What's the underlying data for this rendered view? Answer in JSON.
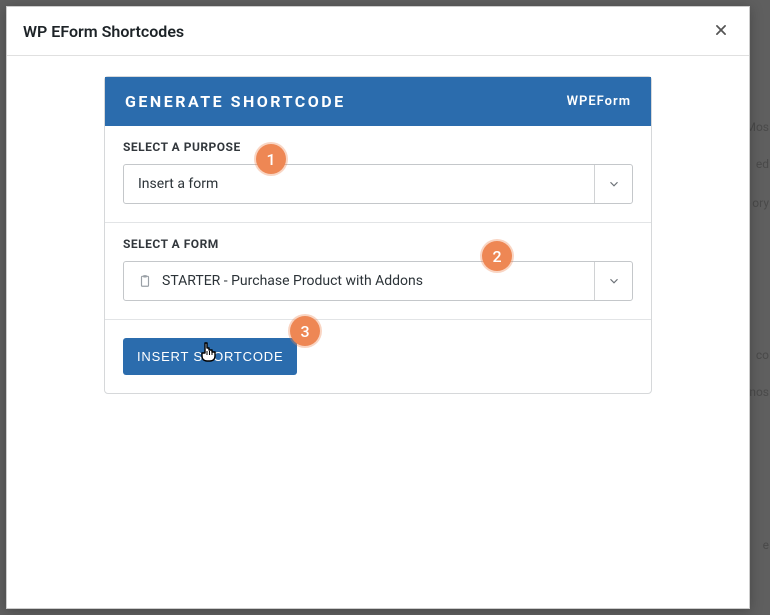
{
  "modal": {
    "title": "WP EForm Shortcodes"
  },
  "card": {
    "title": "GENERATE SHORTCODE",
    "brand": "WPEForm"
  },
  "purpose": {
    "label": "SELECT A PURPOSE",
    "value": "Insert a form"
  },
  "form": {
    "label": "SELECT A FORM",
    "value": "STARTER - Purchase Product with Addons"
  },
  "action": {
    "insert_label": "INSERT SHORTCODE"
  },
  "badges": {
    "one": "1",
    "two": "2",
    "three": "3"
  },
  "bg": {
    "f1": "Mos",
    "f2": "ed",
    "f3": "ory",
    "f4": "co",
    "f5": "nos",
    "f6": "e"
  }
}
